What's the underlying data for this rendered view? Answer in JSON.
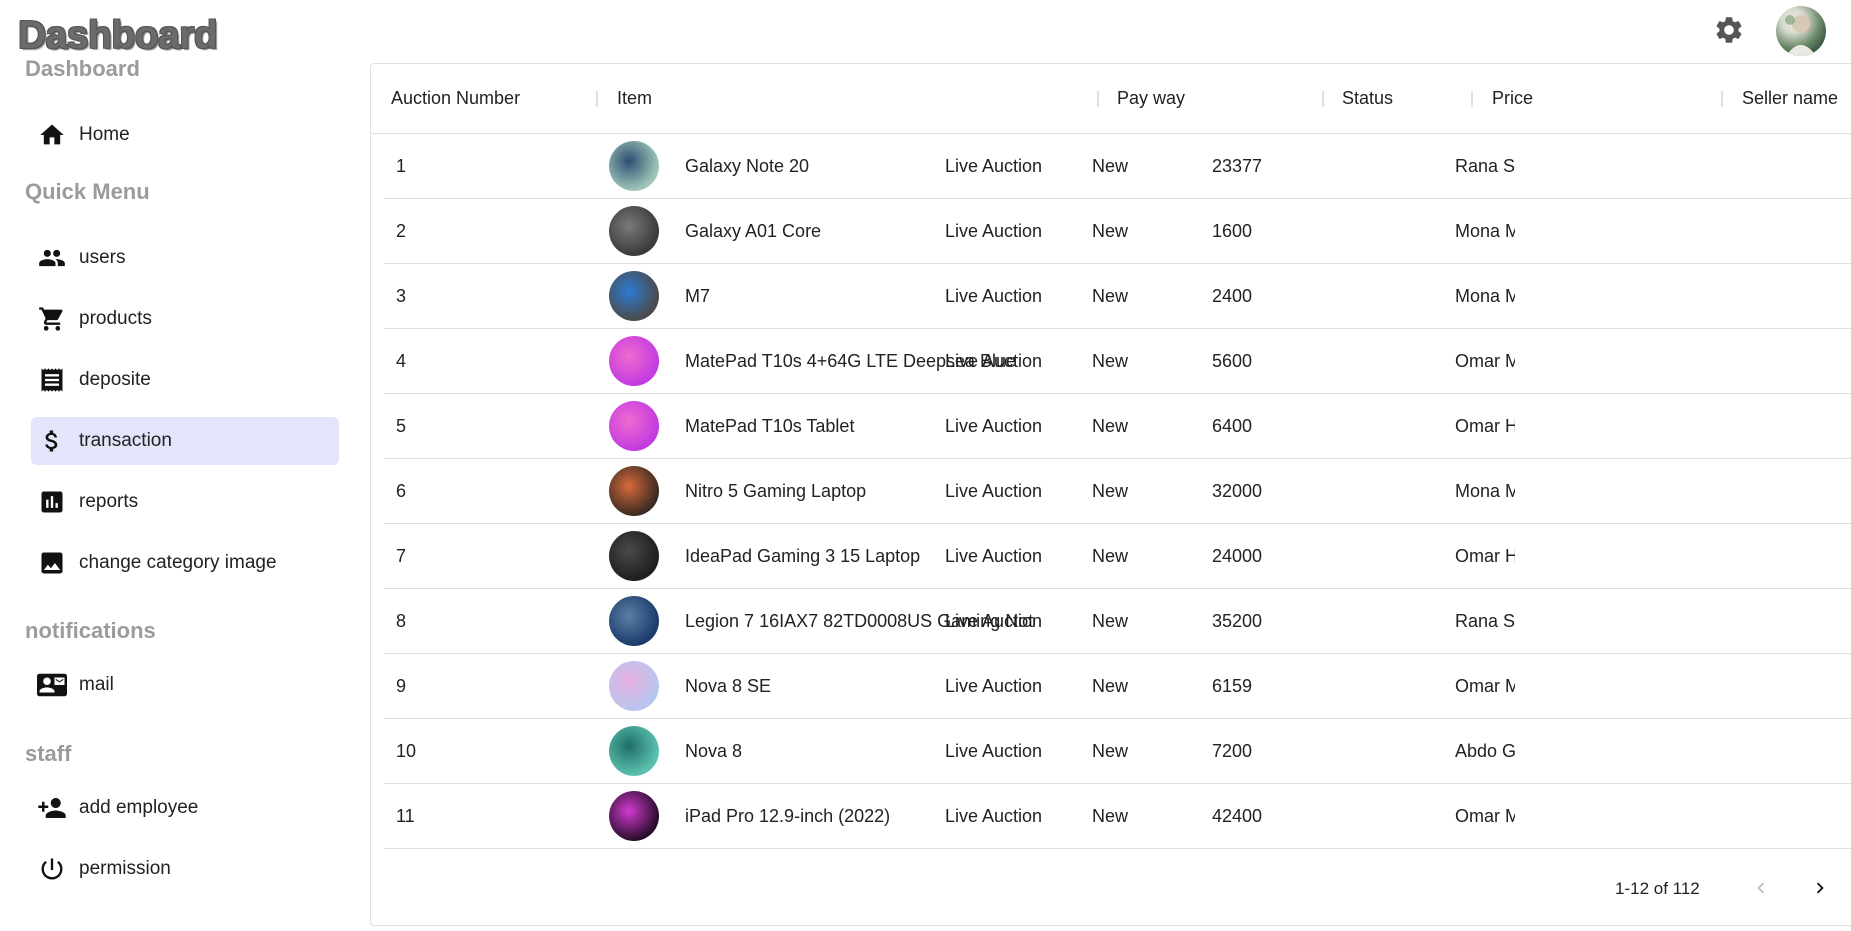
{
  "header": {
    "logo": "Dashboard",
    "settings_icon": "gear-icon",
    "avatar": "user-avatar"
  },
  "sidebar": {
    "sections": [
      {
        "title": "Dashboard",
        "items": [
          {
            "label": "Home",
            "icon": "home-icon"
          }
        ]
      },
      {
        "title": "Quick Menu",
        "items": [
          {
            "label": "users",
            "icon": "people-icon"
          },
          {
            "label": "products",
            "icon": "cart-icon"
          },
          {
            "label": "deposite",
            "icon": "receipt-icon"
          },
          {
            "label": "transaction",
            "icon": "dollar-icon",
            "active": true
          },
          {
            "label": "reports",
            "icon": "bar-chart-icon"
          },
          {
            "label": "change category image",
            "icon": "image-icon"
          }
        ]
      },
      {
        "title": "notifications",
        "items": [
          {
            "label": "mail",
            "icon": "contact-mail-icon"
          }
        ]
      },
      {
        "title": "staff",
        "items": [
          {
            "label": "add employee",
            "icon": "person-add-icon"
          },
          {
            "label": "permission",
            "icon": "power-icon"
          }
        ]
      }
    ],
    "active_color": "#e4e4fb"
  },
  "table": {
    "columns": [
      "Auction Number",
      "Item",
      "Pay way",
      "Status",
      "Price",
      "Seller name"
    ],
    "rows": [
      {
        "num": "1",
        "item": "Galaxy Note 20",
        "pay": "Live Auction",
        "status": "New",
        "price": "23377",
        "seller": "Rana Sayad"
      },
      {
        "num": "2",
        "item": "Galaxy A01 Core",
        "pay": "Live Auction",
        "status": "New",
        "price": "1600",
        "seller": "Mona Mohamed"
      },
      {
        "num": "3",
        "item": "M7",
        "pay": "Live Auction",
        "status": "New",
        "price": "2400",
        "seller": "Mona Mohamed"
      },
      {
        "num": "4",
        "item": "MatePad T10s 4+64G LTE Deepsea Blue",
        "pay": "Live Auction",
        "status": "New",
        "price": "5600",
        "seller": "Omar Magdy"
      },
      {
        "num": "5",
        "item": "MatePad T10s Tablet",
        "pay": "Live Auction",
        "status": "New",
        "price": "6400",
        "seller": "Omar Hany"
      },
      {
        "num": "6",
        "item": "Nitro 5 Gaming Laptop",
        "pay": "Live Auction",
        "status": "New",
        "price": "32000",
        "seller": "Mona Mohamed"
      },
      {
        "num": "7",
        "item": "IdeaPad Gaming 3 15 Laptop",
        "pay": "Live Auction",
        "status": "New",
        "price": "24000",
        "seller": "Omar Hany"
      },
      {
        "num": "8",
        "item": "Legion 7 16IAX7 82TD0008US Gaming Notebook",
        "pay": "Live Auction",
        "status": "New",
        "price": "35200",
        "seller": "Rana Sayad"
      },
      {
        "num": "9",
        "item": "Nova 8 SE",
        "pay": "Live Auction",
        "status": "New",
        "price": "6159",
        "seller": "Omar Magdy"
      },
      {
        "num": "10",
        "item": "Nova 8",
        "pay": "Live Auction",
        "status": "New",
        "price": "7200",
        "seller": "Abdo Gaber"
      },
      {
        "num": "11",
        "item": "iPad Pro 12.9-inch (2022)",
        "pay": "Live Auction",
        "status": "New",
        "price": "42400",
        "seller": "Omar Magdy"
      }
    ]
  },
  "pagination": {
    "range": "1-12 of 112",
    "prev_icon": "chevron-left-icon",
    "next_icon": "chevron-right-icon"
  }
}
